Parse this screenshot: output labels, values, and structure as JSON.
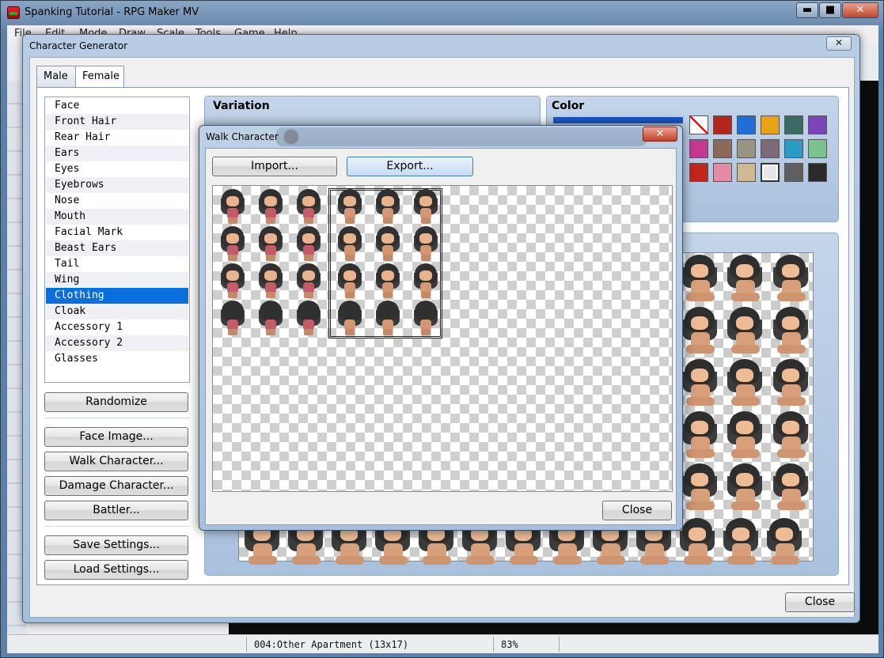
{
  "main_window": {
    "title": "Spanking Tutorial - RPG Maker MV",
    "menu": [
      "File",
      "Edit",
      "Mode",
      "Draw",
      "Scale",
      "Tools",
      "Game",
      "Help"
    ],
    "min_glyph": "▬",
    "max_glyph": "■",
    "close_glyph": "✕"
  },
  "status": {
    "map": "004:Other Apartment (13x17)",
    "zoom": "83%"
  },
  "char_gen": {
    "title": "Character Generator",
    "close_glyph": "✕",
    "tabs": [
      "Male",
      "Female"
    ],
    "active_tab": "Female",
    "parts": [
      "Face",
      "Front Hair",
      "Rear Hair",
      "Ears",
      "Eyes",
      "Eyebrows",
      "Nose",
      "Mouth",
      "Facial Mark",
      "Beast Ears",
      "Tail",
      "Wing",
      "Clothing",
      "Cloak",
      "Accessory 1",
      "Accessory 2",
      "Glasses"
    ],
    "selected_part": "Clothing",
    "buttons": {
      "randomize": "Randomize",
      "face_image": "Face Image...",
      "walk_character": "Walk Character...",
      "damage_character": "Damage Character...",
      "battler": "Battler...",
      "save_settings": "Save Settings...",
      "load_settings": "Load Settings...",
      "close": "Close"
    },
    "variation_label": "Variation",
    "color_label": "Color",
    "color_swatches": [
      "#ffffff",
      "#b3261e",
      "#1f6fd6",
      "#e8a317",
      "#3a6b62",
      "#7b45b8",
      "#c4398f",
      "#8a6a58",
      "#9a9580",
      "#7f6b78",
      "#2a9bc4",
      "#7cc28f",
      "#c2261a",
      "#e58aa3",
      "#cfb892",
      "#e6e6e6",
      "#5f5f5f",
      "#2a2a2a"
    ],
    "selected_swatch": 15
  },
  "walk_dialog": {
    "title": "Walk Character",
    "close_glyph": "✕",
    "import_label": "Import...",
    "export_label": "Export...",
    "close_label": "Close"
  }
}
